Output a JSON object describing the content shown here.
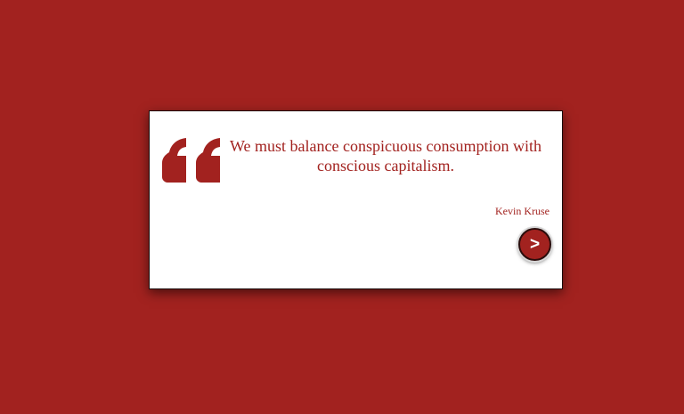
{
  "colors": {
    "background": "#a2221f",
    "card": "#ffffff",
    "accent": "#a2221f"
  },
  "quote": {
    "icon": "quote-mark-icon",
    "text": "We must balance conspicuous consumption with conscious capitalism.",
    "author": "Kevin Kruse"
  },
  "controls": {
    "next_label": ">"
  }
}
